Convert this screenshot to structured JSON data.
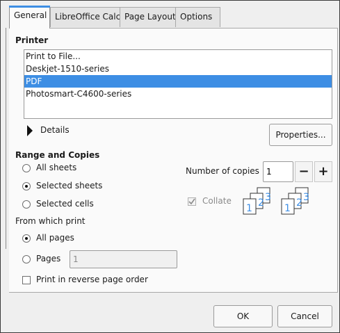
{
  "tabs": [
    "General",
    "LibreOffice Calc",
    "Page Layout",
    "Options"
  ],
  "printer": {
    "heading": "Printer",
    "items": [
      "Print to File...",
      "Deskjet-1510-series",
      "PDF",
      "Photosmart-C4600-series"
    ],
    "selected_index": 2,
    "details_label": "Details",
    "properties_label": "Properties..."
  },
  "range": {
    "heading": "Range and Copies",
    "options": [
      "All sheets",
      "Selected sheets",
      "Selected cells"
    ],
    "selected_index": 1
  },
  "copies": {
    "label": "Number of copies",
    "value": "1",
    "minus": "−",
    "plus": "+",
    "collate_label": "Collate",
    "collate_checked": true
  },
  "from_which": {
    "heading": "From which print",
    "all_pages": "All pages",
    "pages": "Pages",
    "pages_value": "1",
    "reverse": "Print in reverse page order"
  },
  "footer": {
    "ok": "OK",
    "cancel": "Cancel"
  },
  "colors": {
    "accent": "#3d8ee4"
  }
}
